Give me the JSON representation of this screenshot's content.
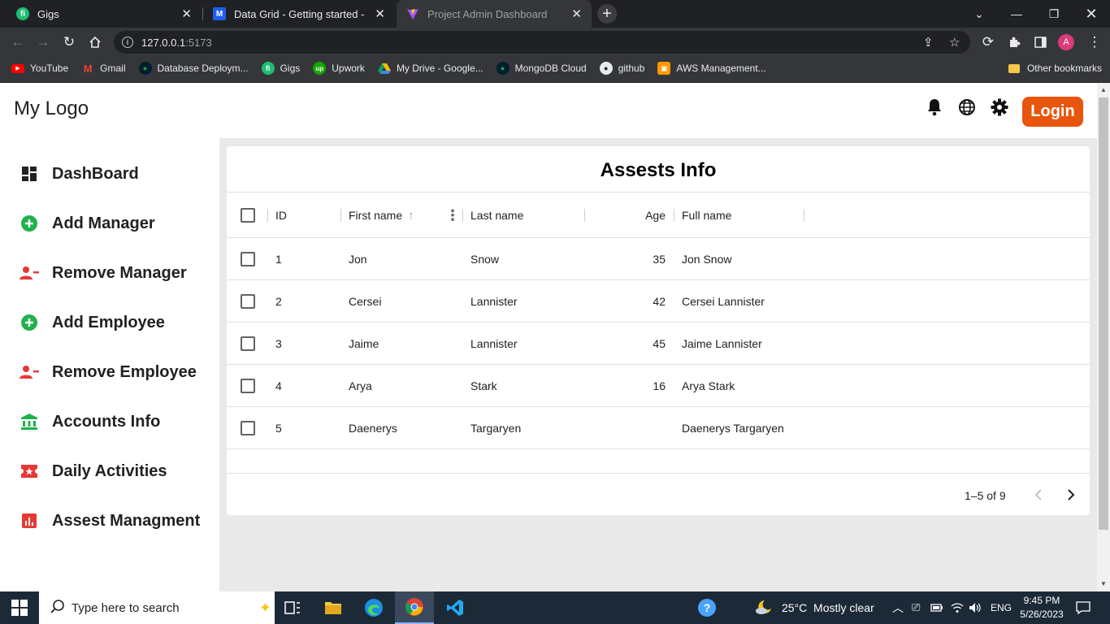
{
  "browser": {
    "tabs": [
      {
        "title": "Gigs",
        "active": false
      },
      {
        "title": "Data Grid - Getting started - MUI",
        "active": false
      },
      {
        "title": "Project Admin Dashboard",
        "active": true
      }
    ],
    "url_host": "127.0.0.1",
    "url_port": ":5173",
    "profile_initial": "A",
    "bookmarks": [
      {
        "label": "YouTube",
        "icon": "youtube-icon",
        "color": "#ff0000"
      },
      {
        "label": "Gmail",
        "icon": "gmail-icon",
        "color": "#ea4335"
      },
      {
        "label": "Database Deploym...",
        "icon": "mongodb-leaf-icon",
        "color": "#13aa52"
      },
      {
        "label": "Gigs",
        "icon": "fiverr-icon",
        "color": "#1dbf73"
      },
      {
        "label": "Upwork",
        "icon": "upwork-icon",
        "color": "#14a800"
      },
      {
        "label": "My Drive - Google...",
        "icon": "google-drive-icon",
        "color": "#fbbc04"
      },
      {
        "label": "MongoDB Cloud",
        "icon": "mongodb-leaf-icon",
        "color": "#13aa52"
      },
      {
        "label": "github",
        "icon": "github-icon",
        "color": "#ffffff"
      },
      {
        "label": "AWS Management...",
        "icon": "aws-icon",
        "color": "#ff9900"
      }
    ],
    "other_bookmarks": "Other bookmarks"
  },
  "app": {
    "logo": "My Logo",
    "login_label": "Login",
    "accent_color": "#e8550d",
    "nav": [
      {
        "label": "DashBoard",
        "icon": "dashboard-icon",
        "color": "#202124"
      },
      {
        "label": "Add Manager",
        "icon": "add-circle-icon",
        "color": "#22b14c"
      },
      {
        "label": "Remove Manager",
        "icon": "person-remove-icon",
        "color": "#e53935"
      },
      {
        "label": "Add Employee",
        "icon": "add-circle-icon",
        "color": "#22b14c"
      },
      {
        "label": "Remove Employee",
        "icon": "person-remove-icon",
        "color": "#e53935"
      },
      {
        "label": "Accounts Info",
        "icon": "bank-icon",
        "color": "#22b14c"
      },
      {
        "label": "Daily Activities",
        "icon": "ticket-star-icon",
        "color": "#e53935"
      },
      {
        "label": "Assest Managment",
        "icon": "bar-chart-icon",
        "color": "#e53935"
      }
    ]
  },
  "grid": {
    "title": "Assests Info",
    "columns": [
      "ID",
      "First name",
      "Last name",
      "Age",
      "Full name"
    ],
    "rows": [
      {
        "id": "1",
        "first": "Jon",
        "last": "Snow",
        "age": "35",
        "full": "Jon Snow"
      },
      {
        "id": "2",
        "first": "Cersei",
        "last": "Lannister",
        "age": "42",
        "full": "Cersei Lannister"
      },
      {
        "id": "3",
        "first": "Jaime",
        "last": "Lannister",
        "age": "45",
        "full": "Jaime Lannister"
      },
      {
        "id": "4",
        "first": "Arya",
        "last": "Stark",
        "age": "16",
        "full": "Arya Stark"
      },
      {
        "id": "5",
        "first": "Daenerys",
        "last": "Targaryen",
        "age": "",
        "full": "Daenerys Targaryen"
      }
    ],
    "pagination": "1–5 of 9"
  },
  "taskbar": {
    "search_placeholder": "Type here to search",
    "weather": "25°C  Mostly clear",
    "language": "ENG",
    "time": "9:45 PM",
    "date": "5/26/2023"
  }
}
